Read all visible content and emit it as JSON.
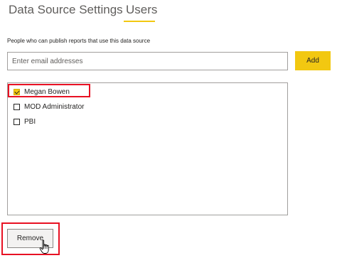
{
  "tabs": [
    {
      "label": "Data Source Settings",
      "active": false
    },
    {
      "label": "Users",
      "active": true
    }
  ],
  "description": "People who can publish reports that use this data source",
  "email": {
    "value": "",
    "placeholder": "Enter email addresses"
  },
  "add_label": "Add",
  "users": [
    {
      "name": "Megan Bowen",
      "checked": true
    },
    {
      "name": "MOD Administrator",
      "checked": false
    },
    {
      "name": "PBI",
      "checked": false
    }
  ],
  "remove_label": "Remove",
  "colors": {
    "accent": "#f2c811",
    "highlight": "#e81123",
    "border": "#a19f9d"
  },
  "icons": {
    "cursor": "hand-pointer-icon",
    "check": "checkmark-icon"
  }
}
